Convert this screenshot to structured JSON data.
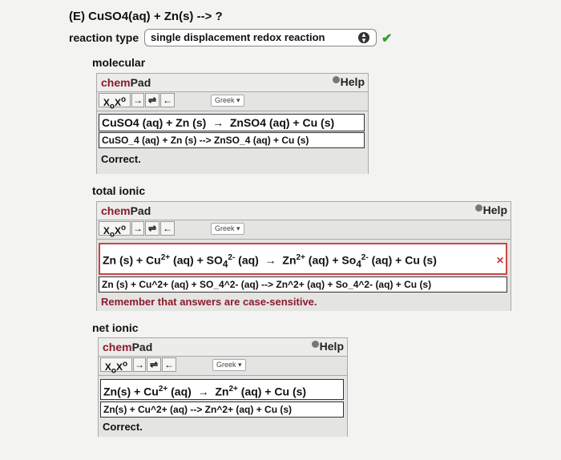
{
  "question": {
    "title": "(E) CuSO4(aq) + Zn(s) --> ?",
    "reaction_type_label": "reaction type",
    "reaction_type_value": "single displacement redox reaction",
    "check_icon": "check-icon"
  },
  "pads": [
    {
      "section_label": "molecular",
      "chem": "chem",
      "pad": "Pad",
      "help": "Help",
      "greek": "Greek",
      "eq_parts": [
        "CuSO4 (aq) + Zn (s)",
        "→",
        "ZnSO4 (aq) + Cu (s)"
      ],
      "text": "CuSO_4 (aq) + Zn (s) --> ZnSO_4 (aq) + Cu (s)",
      "status": "Correct."
    },
    {
      "section_label": "total ionic",
      "chem": "chem",
      "pad": "Pad",
      "help": "Help",
      "greek": "Greek",
      "eq_lhs": "Zn (s) + Cu",
      "eq_sup1": "2+",
      "eq_mid1": " (aq) + SO",
      "eq_sub1": "4",
      "eq_sup2": "2-",
      "eq_mid2": " (aq)",
      "eq_arrow": "→",
      "eq_rhs1": "Zn",
      "eq_sup3": "2+",
      "eq_mid3": " (aq) + So",
      "eq_sub2": "4",
      "eq_sup4": "2-",
      "eq_rhs2": " (aq) + Cu (s)",
      "text": "Zn (s) + Cu^2+ (aq) + SO_4^2- (aq) --> Zn^2+ (aq) + So_4^2- (aq) + Cu (s)",
      "status": "Remember that answers are case-sensitive."
    },
    {
      "section_label": "net ionic",
      "chem": "chem",
      "pad": "Pad",
      "help": "Help",
      "greek": "Greek",
      "eq_lhs": "Zn(s) + Cu",
      "eq_sup1": "2+",
      "eq_mid1": " (aq)",
      "eq_arrow": "→",
      "eq_rhs1": "Zn",
      "eq_sup2": "2+",
      "eq_rhs2": " (aq) + Cu (s)",
      "text": "Zn(s) + Cu^2+ (aq) --> Zn^2+ (aq) + Cu (s)",
      "status": "Correct."
    }
  ],
  "toolbar": {
    "subscript_label": "X",
    "subscript_sub": "o",
    "superscript_label": "X",
    "superscript_sup": "o",
    "arrow": "→",
    "equilibrium": "⇌",
    "back_arrow": "←"
  }
}
